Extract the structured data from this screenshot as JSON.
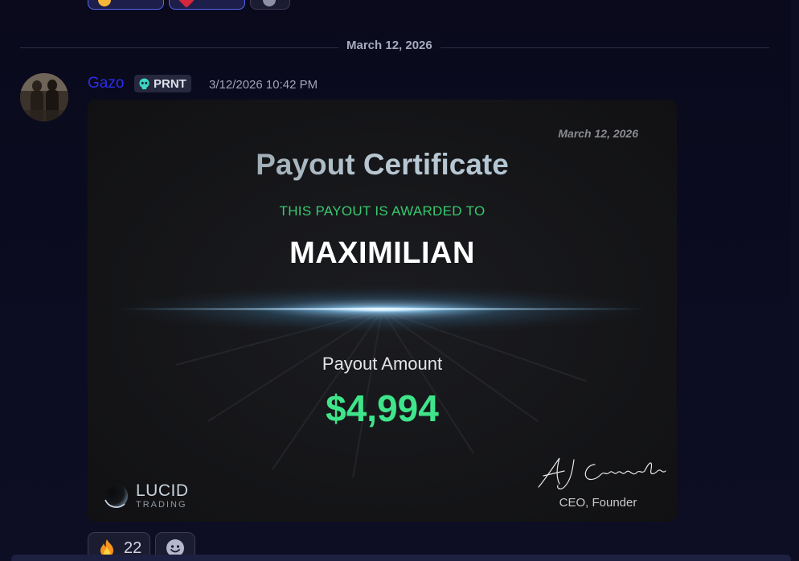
{
  "date_divider": "March 12, 2026",
  "message": {
    "username": "Gazo",
    "tag": "PRNT",
    "timestamp": "3/12/2026 10:42 PM",
    "avatar": "avatar-photo"
  },
  "certificate": {
    "date": "March 12, 2026",
    "title": "Payout Certificate",
    "awarded_to_label": "THIS PAYOUT IS AWARDED TO",
    "recipient": "MAXIMILIAN",
    "amount_label": "Payout Amount",
    "amount": "$4,994",
    "logo_name": "LUCID",
    "logo_sub": "TRADING",
    "signature": "AJ Campanella",
    "signer_role": "CEO, Founder"
  },
  "reactions_bottom": [
    {
      "icon": "fire-icon",
      "count": "22"
    },
    {
      "icon": "add-reaction-icon"
    }
  ],
  "colors": {
    "background": "#0b0b1e",
    "username": "#2c2cf0",
    "accent_green": "#3fe58a",
    "awarded_green": "#37c96e",
    "reaction_active_border": "#5865f2"
  }
}
